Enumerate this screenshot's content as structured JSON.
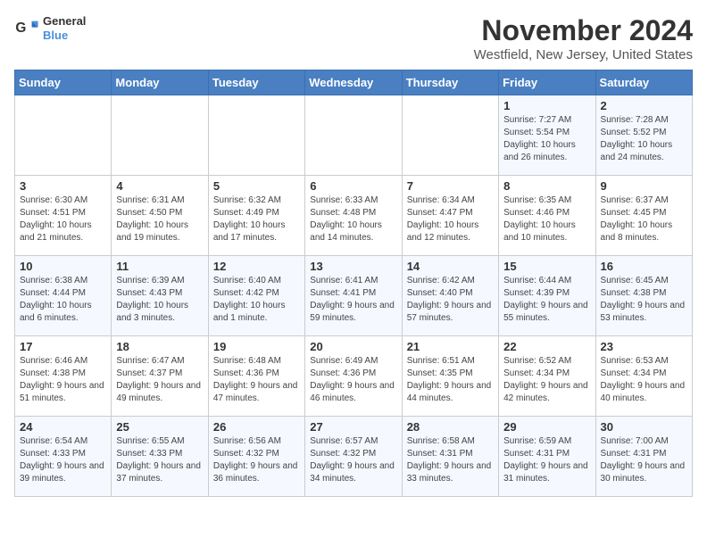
{
  "header": {
    "logo": {
      "line1": "General",
      "line2": "Blue"
    },
    "title": "November 2024",
    "location": "Westfield, New Jersey, United States"
  },
  "days_of_week": [
    "Sunday",
    "Monday",
    "Tuesday",
    "Wednesday",
    "Thursday",
    "Friday",
    "Saturday"
  ],
  "weeks": [
    [
      {
        "day": "",
        "info": ""
      },
      {
        "day": "",
        "info": ""
      },
      {
        "day": "",
        "info": ""
      },
      {
        "day": "",
        "info": ""
      },
      {
        "day": "",
        "info": ""
      },
      {
        "day": "1",
        "info": "Sunrise: 7:27 AM\nSunset: 5:54 PM\nDaylight: 10 hours and 26 minutes."
      },
      {
        "day": "2",
        "info": "Sunrise: 7:28 AM\nSunset: 5:52 PM\nDaylight: 10 hours and 24 minutes."
      }
    ],
    [
      {
        "day": "3",
        "info": "Sunrise: 6:30 AM\nSunset: 4:51 PM\nDaylight: 10 hours and 21 minutes."
      },
      {
        "day": "4",
        "info": "Sunrise: 6:31 AM\nSunset: 4:50 PM\nDaylight: 10 hours and 19 minutes."
      },
      {
        "day": "5",
        "info": "Sunrise: 6:32 AM\nSunset: 4:49 PM\nDaylight: 10 hours and 17 minutes."
      },
      {
        "day": "6",
        "info": "Sunrise: 6:33 AM\nSunset: 4:48 PM\nDaylight: 10 hours and 14 minutes."
      },
      {
        "day": "7",
        "info": "Sunrise: 6:34 AM\nSunset: 4:47 PM\nDaylight: 10 hours and 12 minutes."
      },
      {
        "day": "8",
        "info": "Sunrise: 6:35 AM\nSunset: 4:46 PM\nDaylight: 10 hours and 10 minutes."
      },
      {
        "day": "9",
        "info": "Sunrise: 6:37 AM\nSunset: 4:45 PM\nDaylight: 10 hours and 8 minutes."
      }
    ],
    [
      {
        "day": "10",
        "info": "Sunrise: 6:38 AM\nSunset: 4:44 PM\nDaylight: 10 hours and 6 minutes."
      },
      {
        "day": "11",
        "info": "Sunrise: 6:39 AM\nSunset: 4:43 PM\nDaylight: 10 hours and 3 minutes."
      },
      {
        "day": "12",
        "info": "Sunrise: 6:40 AM\nSunset: 4:42 PM\nDaylight: 10 hours and 1 minute."
      },
      {
        "day": "13",
        "info": "Sunrise: 6:41 AM\nSunset: 4:41 PM\nDaylight: 9 hours and 59 minutes."
      },
      {
        "day": "14",
        "info": "Sunrise: 6:42 AM\nSunset: 4:40 PM\nDaylight: 9 hours and 57 minutes."
      },
      {
        "day": "15",
        "info": "Sunrise: 6:44 AM\nSunset: 4:39 PM\nDaylight: 9 hours and 55 minutes."
      },
      {
        "day": "16",
        "info": "Sunrise: 6:45 AM\nSunset: 4:38 PM\nDaylight: 9 hours and 53 minutes."
      }
    ],
    [
      {
        "day": "17",
        "info": "Sunrise: 6:46 AM\nSunset: 4:38 PM\nDaylight: 9 hours and 51 minutes."
      },
      {
        "day": "18",
        "info": "Sunrise: 6:47 AM\nSunset: 4:37 PM\nDaylight: 9 hours and 49 minutes."
      },
      {
        "day": "19",
        "info": "Sunrise: 6:48 AM\nSunset: 4:36 PM\nDaylight: 9 hours and 47 minutes."
      },
      {
        "day": "20",
        "info": "Sunrise: 6:49 AM\nSunset: 4:36 PM\nDaylight: 9 hours and 46 minutes."
      },
      {
        "day": "21",
        "info": "Sunrise: 6:51 AM\nSunset: 4:35 PM\nDaylight: 9 hours and 44 minutes."
      },
      {
        "day": "22",
        "info": "Sunrise: 6:52 AM\nSunset: 4:34 PM\nDaylight: 9 hours and 42 minutes."
      },
      {
        "day": "23",
        "info": "Sunrise: 6:53 AM\nSunset: 4:34 PM\nDaylight: 9 hours and 40 minutes."
      }
    ],
    [
      {
        "day": "24",
        "info": "Sunrise: 6:54 AM\nSunset: 4:33 PM\nDaylight: 9 hours and 39 minutes."
      },
      {
        "day": "25",
        "info": "Sunrise: 6:55 AM\nSunset: 4:33 PM\nDaylight: 9 hours and 37 minutes."
      },
      {
        "day": "26",
        "info": "Sunrise: 6:56 AM\nSunset: 4:32 PM\nDaylight: 9 hours and 36 minutes."
      },
      {
        "day": "27",
        "info": "Sunrise: 6:57 AM\nSunset: 4:32 PM\nDaylight: 9 hours and 34 minutes."
      },
      {
        "day": "28",
        "info": "Sunrise: 6:58 AM\nSunset: 4:31 PM\nDaylight: 9 hours and 33 minutes."
      },
      {
        "day": "29",
        "info": "Sunrise: 6:59 AM\nSunset: 4:31 PM\nDaylight: 9 hours and 31 minutes."
      },
      {
        "day": "30",
        "info": "Sunrise: 7:00 AM\nSunset: 4:31 PM\nDaylight: 9 hours and 30 minutes."
      }
    ]
  ]
}
